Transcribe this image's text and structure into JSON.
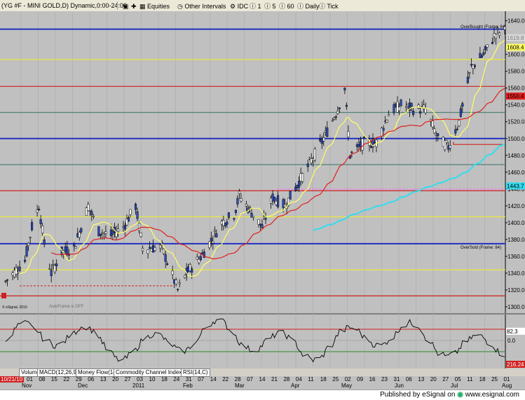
{
  "toolbar": {
    "symbol": "(YG #F - MINI GOLD,D) Dynamic,0:00-24:00",
    "equities": "Equities",
    "other_intervals": "Other Intervals",
    "idc": "IDC",
    "i1": "1",
    "i5": "5",
    "i60": "60",
    "daily": "Daily",
    "tick": "Tick"
  },
  "labels": {
    "overbought": "OverBought (Frame: 84)",
    "oversold": "OverSold (Frame: 84)",
    "autoframe": "AutoFrame is OFF",
    "copyright": "© eSignal, 2010",
    "start_date": "10/21/10",
    "publisher": "Published by eSignal on",
    "site": "www.esignal.com"
  },
  "tabs": [
    "Volume",
    "MACD(12,26,9,C)",
    "Money Flow(14)",
    "Commodity Channel Index(23,C)",
    "RSI(14,C)"
  ],
  "price_axis": [
    "1640.0",
    "1620.0",
    "1600.0",
    "1580.0",
    "1560.0",
    "1540.0",
    "1520.0",
    "1500.0",
    "1480.0",
    "1460.0",
    "1440.0",
    "1420.0",
    "1400.0",
    "1380.0",
    "1360.0",
    "1340.0",
    "1320.0",
    "1300.0"
  ],
  "price_tags": [
    {
      "text": "1619.8",
      "color": "#d8d8d8",
      "value": 1619.8
    },
    {
      "text": "1608.4",
      "color": "#ffff66",
      "value": 1608.4
    },
    {
      "text": "1550.4",
      "color": "#e02020",
      "value": 1550.4
    },
    {
      "text": "1443.7",
      "color": "#33ddee",
      "value": 1443.7
    }
  ],
  "osc_axis": [
    "0.0"
  ],
  "osc_tags": [
    {
      "text": "82.3",
      "value": 82.3
    },
    {
      "text": "216.24",
      "value": 216.24
    }
  ],
  "date_axis": {
    "days": [
      "01",
      "08",
      "15",
      "22",
      "29",
      "06",
      "13",
      "20",
      "27",
      "03",
      "10",
      "18",
      "24",
      "31",
      "07",
      "14",
      "22",
      "28",
      "07",
      "14",
      "21",
      "28",
      "04",
      "11",
      "18",
      "25",
      "02",
      "09",
      "16",
      "23",
      "31",
      "06",
      "13",
      "20",
      "27",
      "05",
      "11",
      "18",
      "25",
      "01"
    ],
    "months": [
      "Nov",
      "Dec",
      "2011",
      "Feb",
      "Mar",
      "Apr",
      "May",
      "Jun",
      "Jul",
      "Aug"
    ]
  },
  "chart_data": {
    "type": "candlestick",
    "title": "(YG #F - MINI GOLD,D) Dynamic,0:00-24:00",
    "ylim": [
      1295,
      1648
    ],
    "x_range": [
      "2010-10-21",
      "2011-08-01"
    ],
    "colors": {
      "up": "#ffffff",
      "down": "#2b4bb8",
      "background": "#c0c0c0",
      "ma_fast": "#ffff66",
      "ma_slow": "#e02020",
      "ma_long": "#33ddee"
    },
    "close_path": [
      [
        "2010-10-21",
        1330
      ],
      [
        "2010-11-01",
        1355
      ],
      [
        "2010-11-05",
        1395
      ],
      [
        "2010-11-09",
        1420
      ],
      [
        "2010-11-12",
        1375
      ],
      [
        "2010-11-16",
        1340
      ],
      [
        "2010-11-22",
        1365
      ],
      [
        "2010-11-29",
        1370
      ],
      [
        "2010-12-07",
        1420
      ],
      [
        "2010-12-13",
        1390
      ],
      [
        "2010-12-20",
        1385
      ],
      [
        "2010-12-27",
        1395
      ],
      [
        "2011-01-03",
        1420
      ],
      [
        "2011-01-07",
        1370
      ],
      [
        "2011-01-18",
        1370
      ],
      [
        "2011-01-27",
        1320
      ],
      [
        "2011-02-01",
        1340
      ],
      [
        "2011-02-10",
        1362
      ],
      [
        "2011-02-21",
        1400
      ],
      [
        "2011-02-28",
        1410
      ],
      [
        "2011-03-03",
        1432
      ],
      [
        "2011-03-10",
        1412
      ],
      [
        "2011-03-16",
        1395
      ],
      [
        "2011-03-22",
        1430
      ],
      [
        "2011-03-29",
        1420
      ],
      [
        "2011-04-05",
        1445
      ],
      [
        "2011-04-12",
        1470
      ],
      [
        "2011-04-20",
        1500
      ],
      [
        "2011-04-28",
        1535
      ],
      [
        "2011-05-02",
        1560
      ],
      [
        "2011-05-05",
        1480
      ],
      [
        "2011-05-13",
        1495
      ],
      [
        "2011-05-20",
        1495
      ],
      [
        "2011-05-27",
        1530
      ],
      [
        "2011-06-03",
        1540
      ],
      [
        "2011-06-10",
        1535
      ],
      [
        "2011-06-17",
        1535
      ],
      [
        "2011-06-24",
        1500
      ],
      [
        "2011-06-30",
        1490
      ],
      [
        "2011-07-06",
        1520
      ],
      [
        "2011-07-13",
        1585
      ],
      [
        "2011-07-20",
        1600
      ],
      [
        "2011-07-27",
        1625
      ],
      [
        "2011-08-01",
        1628
      ]
    ],
    "horizontal_levels": [
      {
        "value": 1630,
        "color": "#2030c0"
      },
      {
        "value": 1594,
        "color": "#e8e840"
      },
      {
        "value": 1562,
        "color": "#d02020"
      },
      {
        "value": 1531,
        "color": "#508078"
      },
      {
        "value": 1500,
        "color": "#2030c0"
      },
      {
        "value": 1469,
        "color": "#508078"
      },
      {
        "value": 1438,
        "color": "#d02020"
      },
      {
        "value": 1407,
        "color": "#e8e840"
      },
      {
        "value": 1375,
        "color": "#2030c0"
      },
      {
        "value": 1344,
        "color": "#e8e840"
      },
      {
        "value": 1313,
        "color": "#d02020"
      }
    ],
    "oscillator": {
      "upper": 100,
      "lower": -100,
      "last": 82.3
    }
  }
}
